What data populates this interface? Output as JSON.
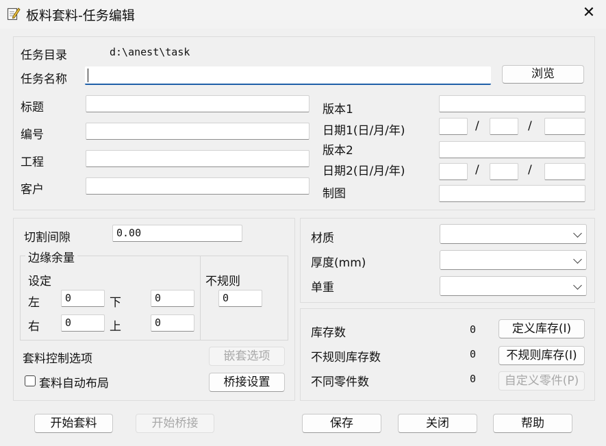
{
  "window": {
    "title": "板料套料-任务编辑",
    "close_glyph": "✕"
  },
  "task": {
    "dir_label": "任务目录",
    "dir_value": "d:\\anest\\task",
    "name_label": "任务名称",
    "name_value": "",
    "browse": "浏览"
  },
  "info": {
    "title_label": "标题",
    "number_label": "编号",
    "project_label": "工程",
    "client_label": "客户",
    "version1_label": "版本1",
    "date1_label": "日期1(日/月/年)",
    "version2_label": "版本2",
    "date2_label": "日期2(日/月/年)",
    "drawing_label": "制图",
    "date_sep": "/"
  },
  "cutting": {
    "gap_label": "切割间隙",
    "gap_value": "0.00",
    "margin_legend": "边缘余量",
    "setting_label": "设定",
    "left_label": "左",
    "left_value": "0",
    "bottom_label": "下",
    "bottom_value": "0",
    "right_label": "右",
    "right_value": "0",
    "top_label": "上",
    "top_value": "0",
    "irregular_label": "不规则",
    "irregular_value": "0",
    "control_label": "套料控制选项",
    "nest_options": "嵌套选项",
    "auto_layout_label": "套料自动布局",
    "bridge_settings": "桥接设置"
  },
  "material": {
    "material_label": "材质",
    "thickness_label": "厚度(mm)",
    "unit_weight_label": "单重"
  },
  "stock": {
    "stock_count_label": "库存数",
    "stock_count_value": "0",
    "define_stock": "定义库存(I)",
    "irregular_stock_label": "不规则库存数",
    "irregular_stock_value": "0",
    "irregular_stock_btn": "不规则库存(I)",
    "distinct_parts_label": "不同零件数",
    "distinct_parts_value": "0",
    "custom_parts": "自定义零件(P)"
  },
  "footer": {
    "start_nesting": "开始套料",
    "start_bridging": "开始桥接",
    "save": "保存",
    "close": "关闭",
    "help": "帮助"
  }
}
